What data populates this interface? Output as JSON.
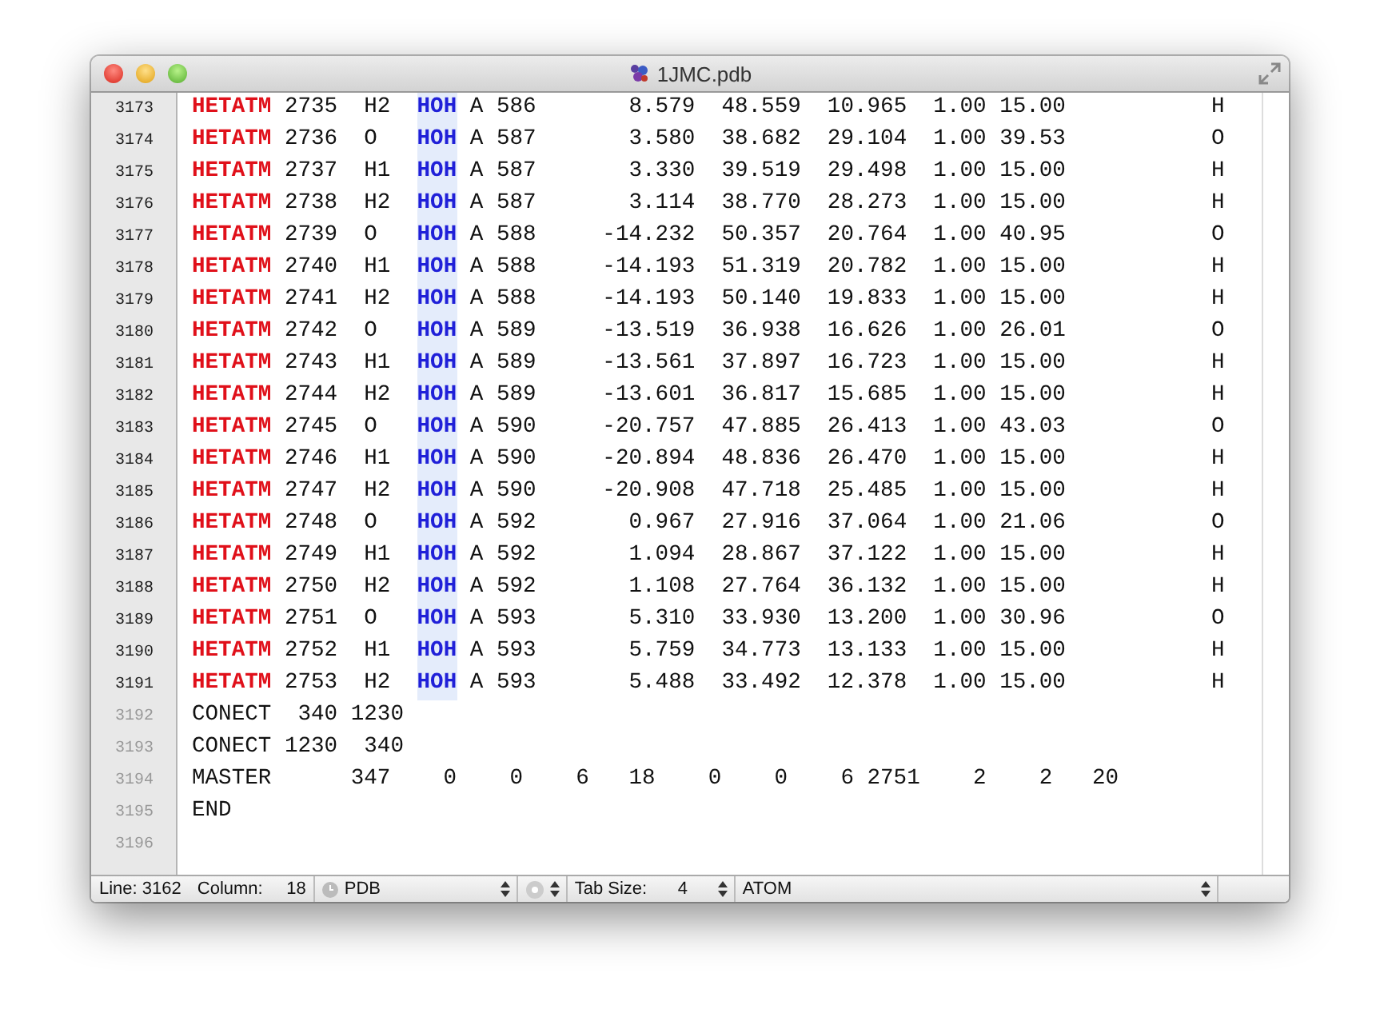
{
  "window": {
    "title": "1JMC.pdb"
  },
  "lines": [
    {
      "number": "3173",
      "selected": true,
      "kind": "hetatm",
      "record": "HETATM",
      "before": " 2735  H2  ",
      "resname": "HOH",
      "after": " A 586       8.579  48.559  10.965  1.00 15.00           H"
    },
    {
      "number": "3174",
      "selected": true,
      "kind": "hetatm",
      "record": "HETATM",
      "before": " 2736  O   ",
      "resname": "HOH",
      "after": " A 587       3.580  38.682  29.104  1.00 39.53           O"
    },
    {
      "number": "3175",
      "selected": true,
      "kind": "hetatm",
      "record": "HETATM",
      "before": " 2737  H1  ",
      "resname": "HOH",
      "after": " A 587       3.330  39.519  29.498  1.00 15.00           H"
    },
    {
      "number": "3176",
      "selected": true,
      "kind": "hetatm",
      "record": "HETATM",
      "before": " 2738  H2  ",
      "resname": "HOH",
      "after": " A 587       3.114  38.770  28.273  1.00 15.00           H"
    },
    {
      "number": "3177",
      "selected": true,
      "kind": "hetatm",
      "record": "HETATM",
      "before": " 2739  O   ",
      "resname": "HOH",
      "after": " A 588     -14.232  50.357  20.764  1.00 40.95           O"
    },
    {
      "number": "3178",
      "selected": true,
      "kind": "hetatm",
      "record": "HETATM",
      "before": " 2740  H1  ",
      "resname": "HOH",
      "after": " A 588     -14.193  51.319  20.782  1.00 15.00           H"
    },
    {
      "number": "3179",
      "selected": true,
      "kind": "hetatm",
      "record": "HETATM",
      "before": " 2741  H2  ",
      "resname": "HOH",
      "after": " A 588     -14.193  50.140  19.833  1.00 15.00           H"
    },
    {
      "number": "3180",
      "selected": true,
      "kind": "hetatm",
      "record": "HETATM",
      "before": " 2742  O   ",
      "resname": "HOH",
      "after": " A 589     -13.519  36.938  16.626  1.00 26.01           O"
    },
    {
      "number": "3181",
      "selected": true,
      "kind": "hetatm",
      "record": "HETATM",
      "before": " 2743  H1  ",
      "resname": "HOH",
      "after": " A 589     -13.561  37.897  16.723  1.00 15.00           H"
    },
    {
      "number": "3182",
      "selected": true,
      "kind": "hetatm",
      "record": "HETATM",
      "before": " 2744  H2  ",
      "resname": "HOH",
      "after": " A 589     -13.601  36.817  15.685  1.00 15.00           H"
    },
    {
      "number": "3183",
      "selected": true,
      "kind": "hetatm",
      "record": "HETATM",
      "before": " 2745  O   ",
      "resname": "HOH",
      "after": " A 590     -20.757  47.885  26.413  1.00 43.03           O"
    },
    {
      "number": "3184",
      "selected": true,
      "kind": "hetatm",
      "record": "HETATM",
      "before": " 2746  H1  ",
      "resname": "HOH",
      "after": " A 590     -20.894  48.836  26.470  1.00 15.00           H"
    },
    {
      "number": "3185",
      "selected": true,
      "kind": "hetatm",
      "record": "HETATM",
      "before": " 2747  H2  ",
      "resname": "HOH",
      "after": " A 590     -20.908  47.718  25.485  1.00 15.00           H"
    },
    {
      "number": "3186",
      "selected": true,
      "kind": "hetatm",
      "record": "HETATM",
      "before": " 2748  O   ",
      "resname": "HOH",
      "after": " A 592       0.967  27.916  37.064  1.00 21.06           O"
    },
    {
      "number": "3187",
      "selected": true,
      "kind": "hetatm",
      "record": "HETATM",
      "before": " 2749  H1  ",
      "resname": "HOH",
      "after": " A 592       1.094  28.867  37.122  1.00 15.00           H"
    },
    {
      "number": "3188",
      "selected": true,
      "kind": "hetatm",
      "record": "HETATM",
      "before": " 2750  H2  ",
      "resname": "HOH",
      "after": " A 592       1.108  27.764  36.132  1.00 15.00           H"
    },
    {
      "number": "3189",
      "selected": true,
      "kind": "hetatm",
      "record": "HETATM",
      "before": " 2751  O   ",
      "resname": "HOH",
      "after": " A 593       5.310  33.930  13.200  1.00 30.96           O"
    },
    {
      "number": "3190",
      "selected": true,
      "kind": "hetatm",
      "record": "HETATM",
      "before": " 2752  H1  ",
      "resname": "HOH",
      "after": " A 593       5.759  34.773  13.133  1.00 15.00           H"
    },
    {
      "number": "3191",
      "selected": true,
      "kind": "hetatm",
      "record": "HETATM",
      "before": " 2753  H2  ",
      "resname": "HOH",
      "after": " A 593       5.488  33.492  12.378  1.00 15.00           H"
    },
    {
      "number": "3192",
      "selected": false,
      "kind": "plain",
      "text": "CONECT  340 1230"
    },
    {
      "number": "3193",
      "selected": false,
      "kind": "plain",
      "text": "CONECT 1230  340"
    },
    {
      "number": "3194",
      "selected": false,
      "kind": "plain",
      "text": "MASTER      347    0    0    6   18    0    0    6 2751    2    2   20"
    },
    {
      "number": "3195",
      "selected": false,
      "kind": "plain",
      "text": "END"
    },
    {
      "number": "3196",
      "selected": false,
      "kind": "empty"
    }
  ],
  "status_bar": {
    "line_label": "Line: 3162",
    "column_label": "Column:",
    "column_value": "18",
    "syntax": "PDB",
    "tab_size_label": "Tab Size:",
    "tab_size_value": "4",
    "symbol": "ATOM"
  }
}
